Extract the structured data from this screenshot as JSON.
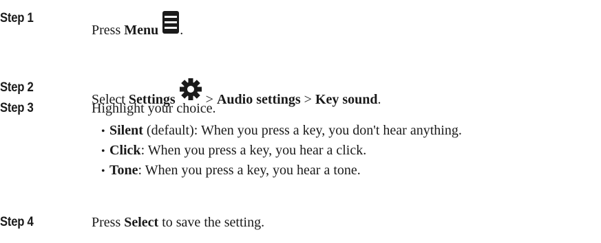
{
  "steps": [
    {
      "label": "Step 1",
      "text_before": "Press ",
      "bold_menu": "Menu",
      "icon": "menu-icon",
      "text_after": "."
    },
    {
      "label": "Step 2",
      "text_before": "Select ",
      "bold_settings": "Settings",
      "icon": "gear-icon",
      "sep1": " > ",
      "bold_audio": "Audio settings",
      "sep2": " > ",
      "bold_key": "Key sound",
      "text_after": "."
    },
    {
      "label": "Step 3",
      "text": "Highlight your choice."
    },
    {
      "label": "Step 4",
      "text_before": "Press ",
      "bold_select": "Select",
      "text_after": " to save the setting."
    }
  ],
  "options": [
    {
      "bullet": "•",
      "name": "Silent",
      "rest": " (default): When you press a key, you don't hear anything."
    },
    {
      "bullet": "•",
      "name": "Click",
      "rest": ": When you press a key, you hear a click."
    },
    {
      "bullet": "•",
      "name": "Tone",
      "rest": ": When you press a key, you hear a tone."
    }
  ]
}
